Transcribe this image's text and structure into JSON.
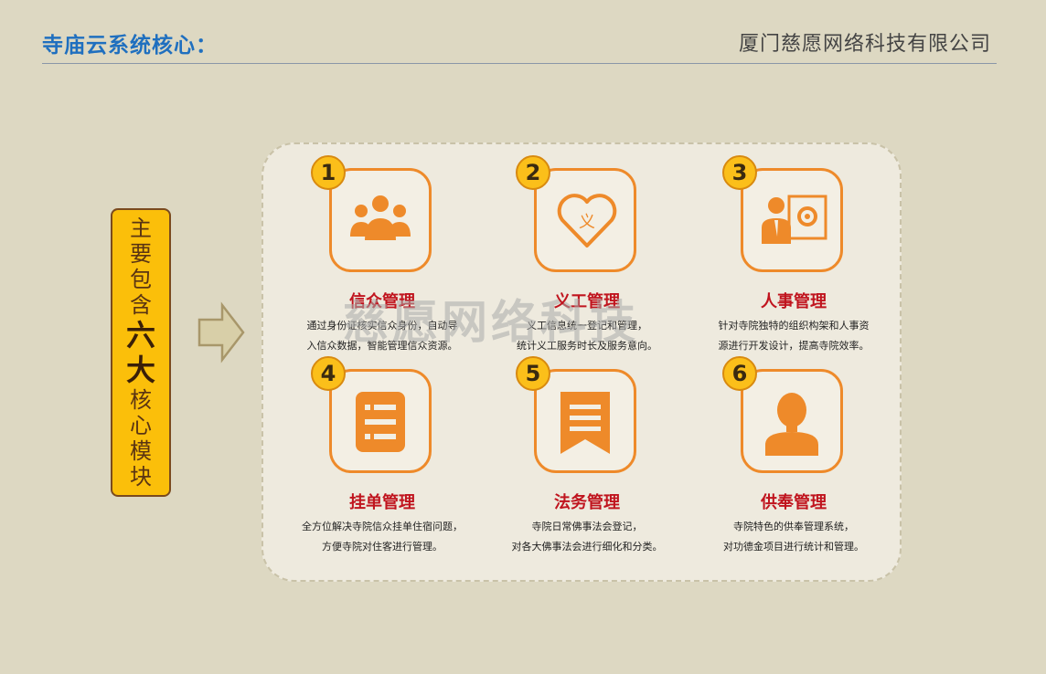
{
  "header": {
    "title": "寺庙云系统核心：",
    "company": "厦门慈愿网络科技有限公司"
  },
  "sidebar": {
    "line1": "主要包含",
    "big": "六大",
    "line2": "核心模块"
  },
  "watermark": "慈愿网络科技",
  "modules": [
    {
      "number": "1",
      "name": "信众管理",
      "desc1": "通过身份证核实信众身份，自动导",
      "desc2": "入信众数据，智能管理信众资源。",
      "icon": "people-group-icon"
    },
    {
      "number": "2",
      "name": "义工管理",
      "desc1": "义工信息统一登记和管理，",
      "desc2": "统计义工服务时长及服务意向。",
      "icon": "heart-icon"
    },
    {
      "number": "3",
      "name": "人事管理",
      "desc1": "针对寺院独特的组织构架和人事资",
      "desc2": "源进行开发设计，提高寺院效率。",
      "icon": "person-gear-icon"
    },
    {
      "number": "4",
      "name": "挂单管理",
      "desc1": "全方位解决寺院信众挂单住宿问题，",
      "desc2": "方便寺院对住客进行管理。",
      "icon": "list-document-icon"
    },
    {
      "number": "5",
      "name": "法务管理",
      "desc1": "寺院日常佛事法会登记，",
      "desc2": "对各大佛事法会进行细化和分类。",
      "icon": "bookmark-icon"
    },
    {
      "number": "6",
      "name": "供奉管理",
      "desc1": "寺院特色的供奉管理系统，",
      "desc2": "对功德金项目进行统计和管理。",
      "icon": "person-silhouette-icon"
    }
  ],
  "colors": {
    "accent": "#ee8a2a",
    "badge": "#fbbf1a",
    "title": "#1f6fbf",
    "module_name": "#c0141e"
  }
}
